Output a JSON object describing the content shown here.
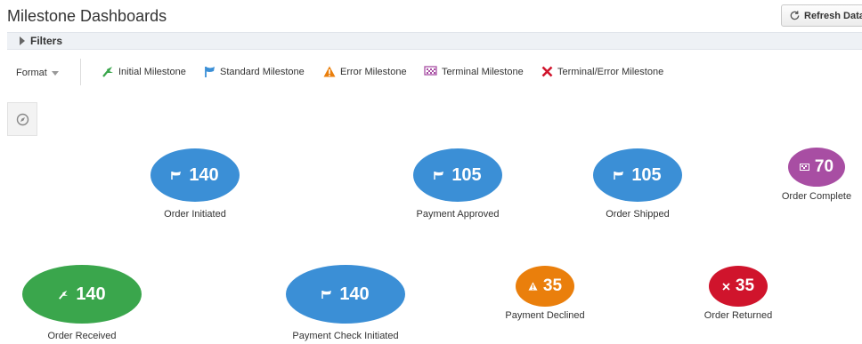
{
  "header": {
    "title": "Milestone Dashboards",
    "refresh_label": "Refresh Data"
  },
  "filters": {
    "label": "Filters"
  },
  "toolbar": {
    "format_label": "Format"
  },
  "legend": [
    {
      "label": "Initial Milestone",
      "icon": "initial-milestone-icon",
      "color": "#3aa64c"
    },
    {
      "label": "Standard Milestone",
      "icon": "standard-milestone-flag-icon",
      "color": "#3b8fd6"
    },
    {
      "label": "Error Milestone",
      "icon": "warning-triangle-icon",
      "color": "#ea7f0c"
    },
    {
      "label": "Terminal Milestone",
      "icon": "checkered-flag-icon",
      "color": "#a84ea3"
    },
    {
      "label": "Terminal/Error Milestone",
      "icon": "x-icon",
      "color": "#d0142c"
    }
  ],
  "nodes": [
    {
      "label": "Order Initiated",
      "count": "140",
      "type": "standard",
      "color": "#3b8fd6"
    },
    {
      "label": "Payment Approved",
      "count": "105",
      "type": "standard",
      "color": "#3b8fd6"
    },
    {
      "label": "Order Shipped",
      "count": "105",
      "type": "standard",
      "color": "#3b8fd6"
    },
    {
      "label": "Order Complete",
      "count": "70",
      "type": "terminal",
      "color": "#a84ea3"
    },
    {
      "label": "Order Received",
      "count": "140",
      "type": "initial",
      "color": "#3aa64c"
    },
    {
      "label": "Payment Check Initiated",
      "count": "140",
      "type": "standard",
      "color": "#3b8fd6"
    },
    {
      "label": "Payment Declined",
      "count": "35",
      "type": "error",
      "color": "#ea7f0c"
    },
    {
      "label": "Order Returned",
      "count": "35",
      "type": "terminal-error",
      "color": "#d0142c"
    }
  ]
}
